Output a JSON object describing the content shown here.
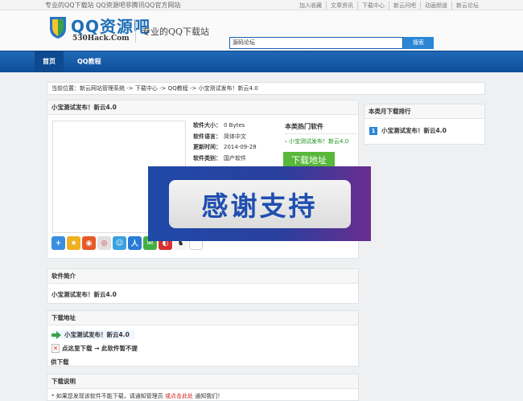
{
  "topbar": {
    "tagline": "专业的QQ下载站 QQ资源吧非腾讯QQ官方网站",
    "links": [
      "加入收藏",
      "文章资讯",
      "下载中心",
      "新云问吧",
      "动画频道",
      "新云论坛"
    ]
  },
  "header": {
    "logo_text": "QQ资源吧",
    "logo_sub": "530Hack.Com",
    "slogan": "专业的QQ下载站",
    "search_value": "源码论坛",
    "search_button": "搜索"
  },
  "nav": {
    "items": [
      "首页",
      "QQ教程"
    ]
  },
  "breadcrumb": "当前位置：新云网站管理系统 -> 下载中心 -> QQ教程 -> 小宝测试发布！新云4.0",
  "main": {
    "title": "小宝测试发布！新云4.0",
    "info": [
      {
        "label": "软件大小：",
        "value": "0 Bytes"
      },
      {
        "label": "软件语言：",
        "value": "简体中文"
      },
      {
        "label": "更新时间：",
        "value": "2014-09-28"
      },
      {
        "label": "软件类别：",
        "value": "国产软件"
      }
    ],
    "hot_title": "本类热门软件",
    "hot_item": "小宝测试发布！新云4.0",
    "download_button": "下载地址",
    "overlay_text": "感谢支持"
  },
  "side": {
    "title": "本类月下载排行",
    "rank_num": "1",
    "rank_item": "小宝测试发布！新云4.0"
  },
  "intro": {
    "title": "软件简介",
    "body": "小宝测试发布！新云4.0"
  },
  "download": {
    "title": "下载地址",
    "link": "小宝测试发布！新云4.0",
    "notice": "点这里下载 → 此软件暂不提",
    "notice_cont": "供下载"
  },
  "explain": {
    "title": "下载说明",
    "body_a": "* 如果您发现该软件不能下载，请通知管理员",
    "body_red": "或点击此处",
    "body_b": "通知我们！"
  },
  "colors": {
    "nav_blue": "#1a5fae",
    "accent_green": "#59b73a",
    "link_green": "#1a8f1a"
  }
}
